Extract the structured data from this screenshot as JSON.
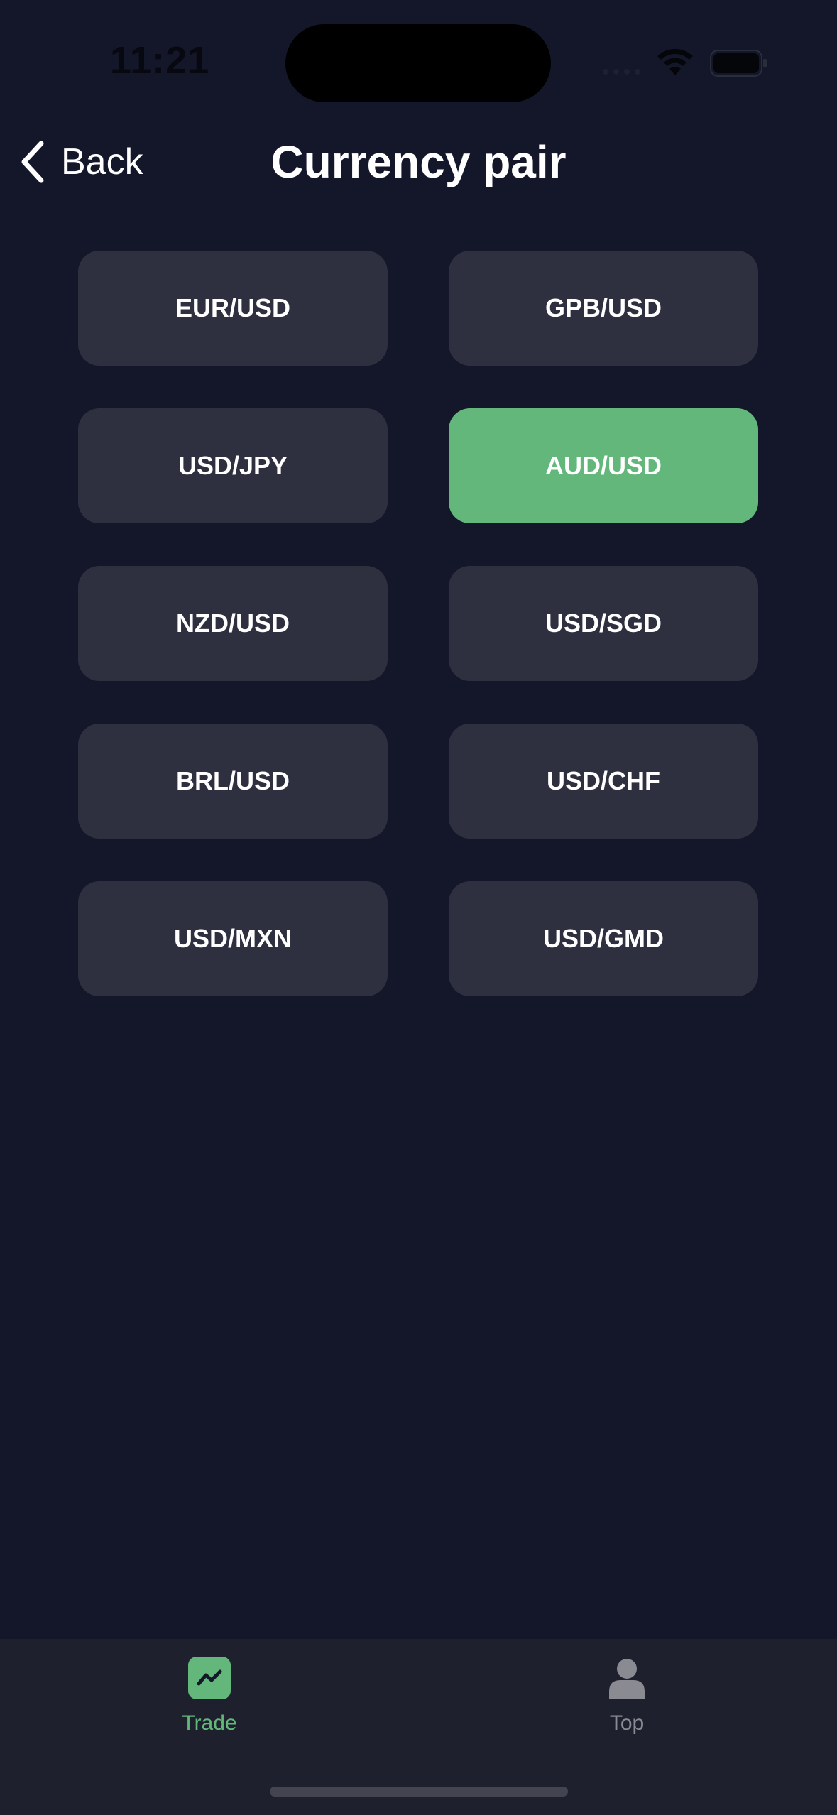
{
  "status_bar": {
    "time": "11:21"
  },
  "header": {
    "back_label": "Back",
    "title": "Currency pair"
  },
  "pairs": [
    {
      "label": "EUR/USD",
      "selected": false
    },
    {
      "label": "GPB/USD",
      "selected": false
    },
    {
      "label": "USD/JPY",
      "selected": false
    },
    {
      "label": "AUD/USD",
      "selected": true
    },
    {
      "label": "NZD/USD",
      "selected": false
    },
    {
      "label": "USD/SGD",
      "selected": false
    },
    {
      "label": "BRL/USD",
      "selected": false
    },
    {
      "label": "USD/CHF",
      "selected": false
    },
    {
      "label": "USD/MXN",
      "selected": false
    },
    {
      "label": "USD/GMD",
      "selected": false
    }
  ],
  "tab_bar": {
    "tabs": [
      {
        "label": "Trade",
        "icon": "chart-line-icon",
        "active": true
      },
      {
        "label": "Top",
        "icon": "person-icon",
        "active": false
      }
    ]
  },
  "colors": {
    "background": "#14172a",
    "button": "#2e303f",
    "accent": "#63b77b",
    "tab_bar": "#1f202d"
  }
}
